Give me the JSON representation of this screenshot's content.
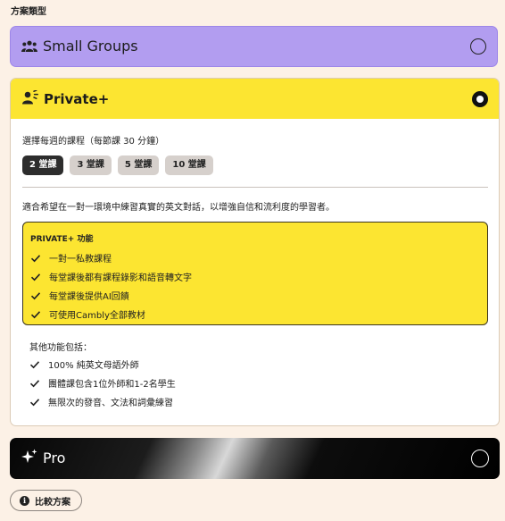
{
  "section_title": "方案類型",
  "plans": {
    "small_groups": {
      "label": "Small Groups"
    },
    "private_plus": {
      "label": "Private+",
      "weekly_label": "選擇每週的課程（每節課 30 分鐘）",
      "chips": [
        "2 堂課",
        "3 堂課",
        "5 堂課",
        "10 堂課"
      ],
      "selected_chip": "2 堂課",
      "description": "適合希望在一對一環境中練習真實的英文對話，以增強自信和流利度的學習者。",
      "features_title": "PRIVATE+ 功能",
      "features": [
        "一對一私教課程",
        "每堂課後都有課程錄影和語音轉文字",
        "每堂課後提供AI回饋",
        "可使用Cambly全部教材"
      ],
      "extra_title": "其他功能包括：",
      "extras": [
        "100% 純英文母語外師",
        "團體課包含1位外師和1-2名學生",
        "無限次的發音、文法和詞彙練習"
      ]
    },
    "pro": {
      "label": "Pro"
    }
  },
  "compare_button": "比較方案",
  "colors": {
    "page_bg": "#fcf1e6",
    "small_groups_bg": "#b29df0",
    "private_accent": "#fce531",
    "chip_active": "#2d2d2d"
  },
  "icons": {
    "small_groups": "group-icon",
    "private_plus": "person-speaking-icon",
    "pro": "sparkle-icon",
    "compare": "info-icon",
    "feature": "check-icon"
  }
}
